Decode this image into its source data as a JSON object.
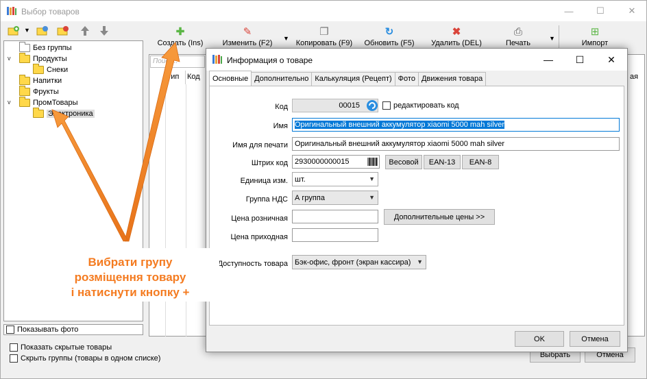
{
  "window": {
    "title": "Выбор товаров",
    "minimize": "—",
    "maximize": "☐",
    "close": "✕"
  },
  "tree": {
    "items": [
      {
        "label": "Без группы"
      },
      {
        "label": "Продукты"
      },
      {
        "label": "Снеки"
      },
      {
        "label": "Напитки"
      },
      {
        "label": "Фрукты"
      },
      {
        "label": "ПромТовары"
      },
      {
        "label": "Электроника"
      }
    ],
    "show_photo": "Показывать фото"
  },
  "toolbar": {
    "create": "Создать (Ins)",
    "edit": "Изменить (F2)",
    "copy": "Копировать (F9)",
    "refresh": "Обновить (F5)",
    "delete": "Удалить (DEL)",
    "print": "Печать",
    "import": "Импорт"
  },
  "grid": {
    "search_placeholder": "Поиск...",
    "col_tip": "Тип",
    "col_code": "Код",
    "col_partial": "ая"
  },
  "bottom": {
    "show_hidden": "Показать скрытые товары",
    "hide_groups": "Скрыть группы (товары в одном списке)",
    "select_btn": "Выбрать",
    "cancel_btn": "Отмена"
  },
  "dialog": {
    "title": "Информация о товаре",
    "tabs": [
      "Основные",
      "Дополнительно",
      "Калькуляция (Рецепт)",
      "Фото",
      "Движения товара"
    ],
    "code_label": "Код",
    "code_value": "00015",
    "edit_code": "редактировать код",
    "name_label": "Имя",
    "name_value": "Оригинальный внешний аккумулятор xiaomi 5000 mah silver",
    "print_name_label": "Имя для печати",
    "print_name_value": "Оригинальный внешний аккумулятор xiaomi 5000 mah silver",
    "barcode_label": "Штрих код",
    "barcode_value": "2930000000015",
    "weight_btn": "Весовой",
    "ean13_btn": "EAN-13",
    "ean8_btn": "EAN-8",
    "unit_label": "Единица изм.",
    "unit_value": "шт.",
    "vat_label": "Группа НДС",
    "vat_value": "А группа",
    "retail_label": "Цена розничная",
    "retail_value": "",
    "extra_prices_btn": "Дополнительные цены >>",
    "purchase_label": "Цена приходная",
    "purchase_value": "",
    "availability_label": "Доступность товара",
    "availability_value": "Бэк-офис, фронт (экран кассира)",
    "ok": "OK",
    "cancel": "Отмена"
  },
  "annotation": {
    "line1": "Вибрати групу",
    "line2": "розміщення товару",
    "line3": "і натиснути кнопку +"
  },
  "colors": {
    "annotation": "#f47b20",
    "selection": "#0078d7"
  }
}
